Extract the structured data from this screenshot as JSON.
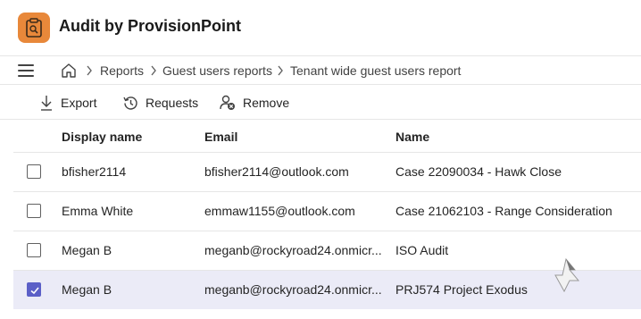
{
  "app": {
    "title": "Audit by ProvisionPoint",
    "accent": "#e8883a"
  },
  "breadcrumb": [
    "Reports",
    "Guest users reports",
    "Tenant wide guest users report"
  ],
  "toolbar": {
    "export": "Export",
    "requests": "Requests",
    "remove": "Remove"
  },
  "table": {
    "columns": [
      "Display name",
      "Email",
      "Name"
    ],
    "rows": [
      {
        "checked": false,
        "display_name": "bfisher2114",
        "email": "bfisher2114@outlook.com",
        "name": "Case 22090034 - Hawk Close"
      },
      {
        "checked": false,
        "display_name": "Emma White",
        "email": "emmaw1155@outlook.com",
        "name": "Case 21062103 - Range Consideration"
      },
      {
        "checked": false,
        "display_name": "Megan B",
        "email": "meganb@rockyroad24.onmicr...",
        "name": "ISO Audit"
      },
      {
        "checked": true,
        "display_name": "Megan B",
        "email": "meganb@rockyroad24.onmicr...",
        "name": "PRJ574 Project Exodus"
      }
    ]
  },
  "colors": {
    "selected_row": "#ebebf7",
    "checkbox_checked": "#5b5fc7"
  }
}
